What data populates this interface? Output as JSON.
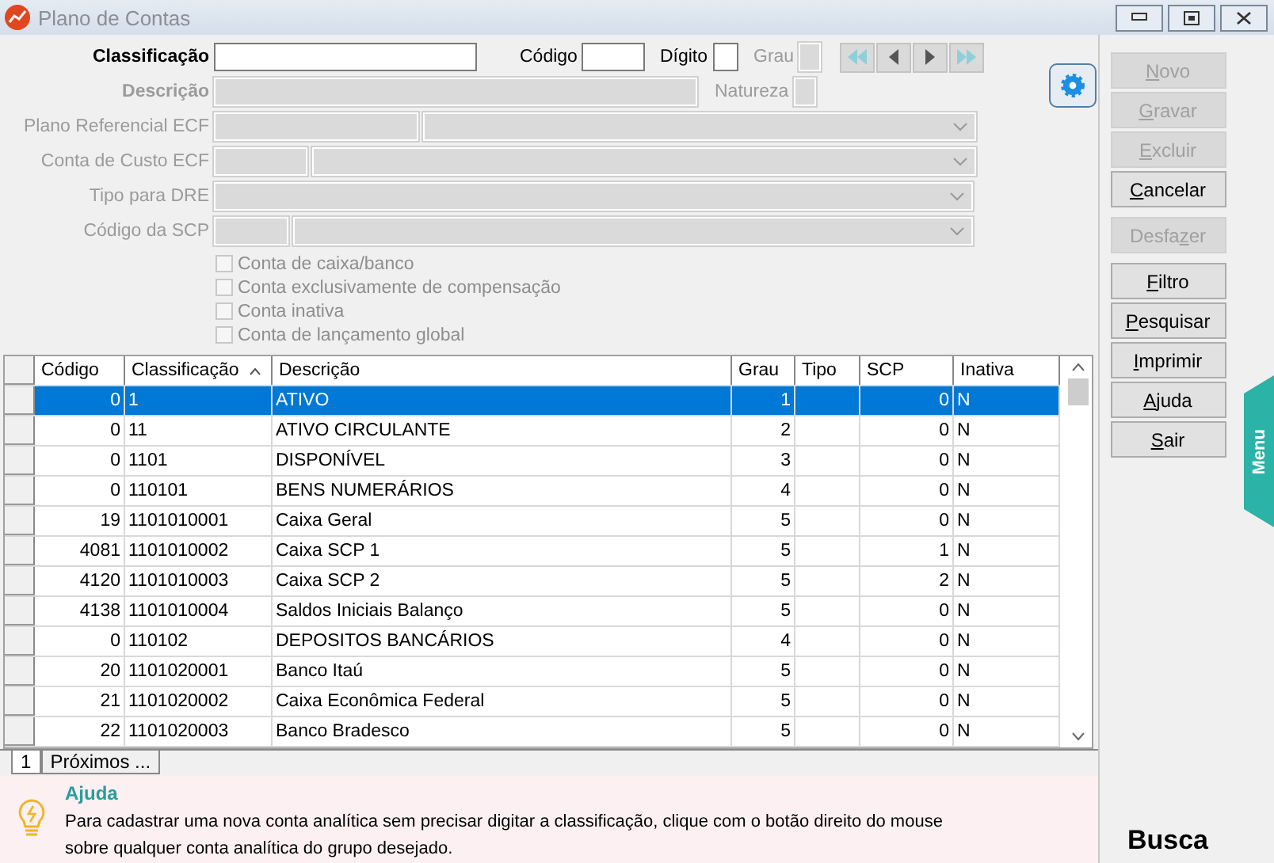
{
  "window": {
    "title": "Plano de Contas"
  },
  "form": {
    "classificacao": {
      "label": "Classificação",
      "required": true,
      "disabled": false
    },
    "codigo": {
      "label": "Código",
      "disabled": false
    },
    "digito": {
      "label": "Dígito",
      "disabled": false
    },
    "grau": {
      "label": "Grau",
      "disabled": true
    },
    "descricao": {
      "label": "Descrição",
      "required": true,
      "disabled": true
    },
    "natureza": {
      "label": "Natureza",
      "disabled": true
    },
    "plano_referencial": {
      "label": "Plano Referencial ECF",
      "disabled": true
    },
    "conta_custo": {
      "label": "Conta de Custo ECF",
      "disabled": true
    },
    "tipo_dre": {
      "label": "Tipo para DRE",
      "disabled": true
    },
    "codigo_scp": {
      "label": "Código da SCP",
      "disabled": true
    }
  },
  "checkboxes": [
    {
      "label": "Conta de caixa/banco",
      "checked": false,
      "disabled": true
    },
    {
      "label": "Conta exclusivamente de compensação",
      "checked": false,
      "disabled": true
    },
    {
      "label": "Conta inativa",
      "checked": false,
      "disabled": true
    },
    {
      "label": "Conta de lançamento global",
      "checked": false,
      "disabled": true
    }
  ],
  "actions": [
    {
      "key": "N",
      "after": "ovo",
      "disabled": true
    },
    {
      "key": "G",
      "after": "ravar",
      "disabled": true
    },
    {
      "key": "E",
      "after": "xcluir",
      "disabled": true
    },
    {
      "key": "C",
      "after": "ancelar",
      "disabled": false
    },
    {
      "before": "Desfa",
      "key": "z",
      "after": "er",
      "disabled": true
    },
    {
      "key": "F",
      "after": "iltro",
      "disabled": false
    },
    {
      "key": "P",
      "after": "esquisar",
      "disabled": false
    },
    {
      "key": "I",
      "after": "mprimir",
      "disabled": false
    },
    {
      "key": "A",
      "after": "juda",
      "disabled": false
    },
    {
      "key": "S",
      "after": "air",
      "disabled": false
    }
  ],
  "table": {
    "columns": [
      {
        "label": "Código",
        "sorted": false
      },
      {
        "label": "Classificação",
        "sorted": true
      },
      {
        "label": "Descrição",
        "sorted": false
      },
      {
        "label": "Grau",
        "sorted": false
      },
      {
        "label": "Tipo",
        "sorted": false
      },
      {
        "label": "SCP",
        "sorted": false
      },
      {
        "label": "Inativa",
        "sorted": false
      }
    ],
    "rows": [
      {
        "codigo": "0",
        "classificacao": "1",
        "descricao": "ATIVO",
        "grau": "1",
        "scp": "0",
        "inativa": "N",
        "selected": true
      },
      {
        "codigo": "0",
        "classificacao": "11",
        "descricao": "ATIVO CIRCULANTE",
        "grau": "2",
        "scp": "0",
        "inativa": "N",
        "selected": false
      },
      {
        "codigo": "0",
        "classificacao": "1101",
        "descricao": "DISPONÍVEL",
        "grau": "3",
        "scp": "0",
        "inativa": "N",
        "selected": false
      },
      {
        "codigo": "0",
        "classificacao": "110101",
        "descricao": "BENS NUMERÁRIOS",
        "grau": "4",
        "scp": "0",
        "inativa": "N",
        "selected": false
      },
      {
        "codigo": "19",
        "classificacao": "1101010001",
        "descricao": "Caixa Geral",
        "grau": "5",
        "scp": "0",
        "inativa": "N",
        "selected": false
      },
      {
        "codigo": "4081",
        "classificacao": "1101010002",
        "descricao": "Caixa SCP 1",
        "grau": "5",
        "scp": "1",
        "inativa": "N",
        "selected": false
      },
      {
        "codigo": "4120",
        "classificacao": "1101010003",
        "descricao": "Caixa SCP 2",
        "grau": "5",
        "scp": "2",
        "inativa": "N",
        "selected": false
      },
      {
        "codigo": "4138",
        "classificacao": "1101010004",
        "descricao": "Saldos Iniciais Balanço",
        "grau": "5",
        "scp": "0",
        "inativa": "N",
        "selected": false
      },
      {
        "codigo": "0",
        "classificacao": "110102",
        "descricao": "DEPOSITOS BANCÁRIOS",
        "grau": "4",
        "scp": "0",
        "inativa": "N",
        "selected": false
      },
      {
        "codigo": "20",
        "classificacao": "1101020001",
        "descricao": "Banco Itaú",
        "grau": "5",
        "scp": "0",
        "inativa": "N",
        "selected": false
      },
      {
        "codigo": "21",
        "classificacao": "1101020002",
        "descricao": "Caixa Econômica Federal",
        "grau": "5",
        "scp": "0",
        "inativa": "N",
        "selected": false
      },
      {
        "codigo": "22",
        "classificacao": "1101020003",
        "descricao": "Banco Bradesco",
        "grau": "5",
        "scp": "0",
        "inativa": "N",
        "selected": false
      }
    ]
  },
  "tabs": [
    {
      "label": "1",
      "selected": true
    },
    {
      "label": "Próximos ...",
      "selected": false
    }
  ],
  "help": {
    "title": "Ajuda",
    "text": "Para cadastrar uma nova conta analítica sem precisar digitar a classificação, clique com o botão direito do mouse sobre qualquer conta analítica do grupo desejado."
  },
  "search_label": "Busca",
  "side_tab": "Menu"
}
